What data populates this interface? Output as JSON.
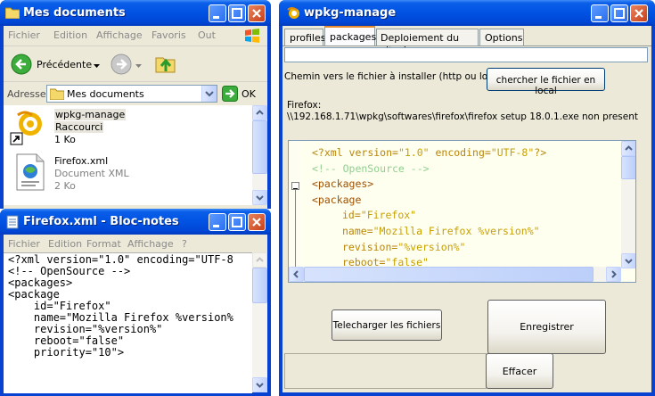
{
  "explorer": {
    "title": "Mes documents",
    "menu": [
      "Fichier",
      "Edition",
      "Affichage",
      "Favoris",
      "Out"
    ],
    "back_label": "Précédente",
    "address_label": "Adresse",
    "address_value": "Mes documents",
    "ok_label": "OK",
    "files": [
      {
        "name": "wpkg-manage",
        "type": "Raccourci",
        "size": "1 Ko"
      },
      {
        "name": "Firefox.xml",
        "type": "Document XML",
        "size": "2 Ko"
      }
    ]
  },
  "notepad": {
    "title": "Firefox.xml - Bloc-notes",
    "menu": [
      "Fichier",
      "Edition",
      "Format",
      "Affichage",
      "?"
    ],
    "lines": [
      "<?xml version=\"1.0\" encoding=\"UTF-8",
      "<!-- OpenSource -->",
      "<packages>",
      "<package",
      "    id=\"Firefox\"",
      "    name=\"Mozilla Firefox %version%",
      "    revision=\"%version%\"",
      "    reboot=\"false\"",
      "    priority=\"10\">"
    ]
  },
  "wpkg": {
    "title": "wpkg-manage",
    "tabs": [
      "profiles",
      "packages",
      "Deploiement du client",
      "Options"
    ],
    "active_tab": "packages",
    "path_input": "",
    "path_label": "Chemin vers le fichier à installer (http ou local)",
    "browse_button": "chercher le fichier en local",
    "status_line1": "Firefox:",
    "status_line2": "\\\\192.168.1.71\\wpkg\\softwares\\firefox\\firefox setup 18.0.1.exe non present",
    "code_lines": [
      {
        "indent": 0,
        "parts": [
          [
            "#b8860b",
            "<?xml "
          ],
          [
            "#b8860b",
            "version="
          ],
          [
            "#c8a000",
            "\"1.0\" "
          ],
          [
            "#b8860b",
            "encoding="
          ],
          [
            "#c8a000",
            "\"UTF-8\""
          ],
          [
            "#b8860b",
            "?>"
          ]
        ]
      },
      {
        "indent": 0,
        "parts": [
          [
            "#8fd08f",
            "<!-- OpenSource -->"
          ]
        ]
      },
      {
        "indent": 0,
        "fold": true,
        "parts": [
          [
            "#a05000",
            "<packages>"
          ]
        ]
      },
      {
        "indent": 0,
        "parts": [
          [
            "#a05000",
            "<package"
          ]
        ]
      },
      {
        "indent": 2,
        "parts": [
          [
            "#b8860b",
            "id="
          ],
          [
            "#c8a000",
            "\"Firefox\""
          ]
        ]
      },
      {
        "indent": 2,
        "parts": [
          [
            "#b8860b",
            "name="
          ],
          [
            "#c8a000",
            "\"Mozilla Firefox %version%\""
          ]
        ]
      },
      {
        "indent": 2,
        "parts": [
          [
            "#b8860b",
            "revision="
          ],
          [
            "#c8a000",
            "\"%version%\""
          ]
        ]
      },
      {
        "indent": 2,
        "parts": [
          [
            "#b8860b",
            "reboot="
          ],
          [
            "#c8a000",
            "\"false\""
          ]
        ]
      }
    ],
    "download_button": "Telecharger les fichiers",
    "save_button": "Enregistrer",
    "clear_button": "Effacer"
  }
}
